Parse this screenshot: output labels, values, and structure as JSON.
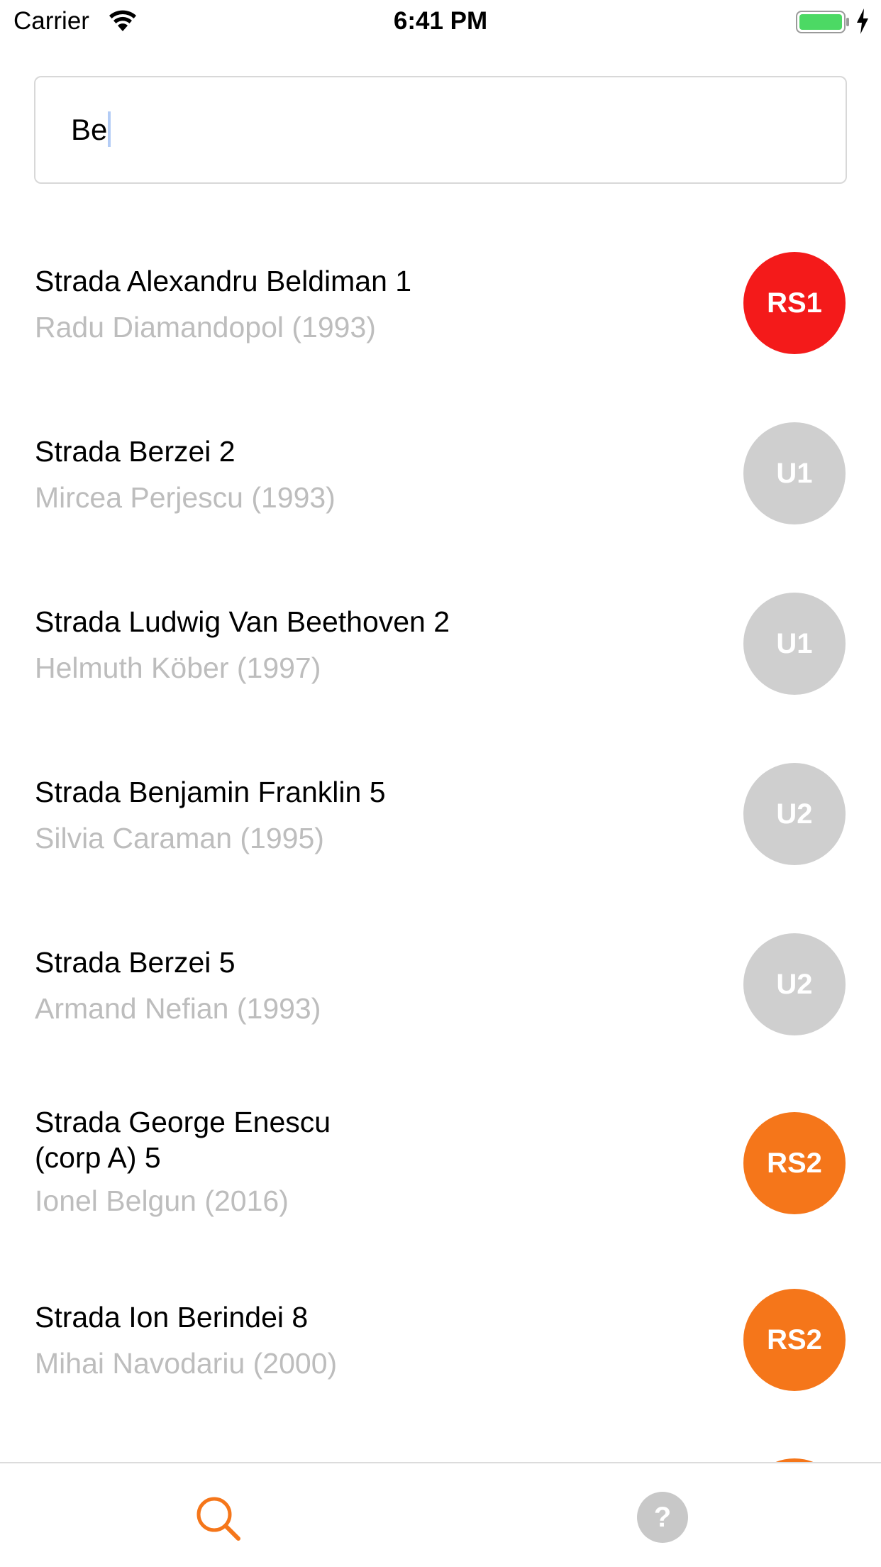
{
  "status_bar": {
    "carrier": "Carrier",
    "time": "6:41 PM",
    "battery_color": "#4cd964"
  },
  "search": {
    "value": "Be"
  },
  "results": [
    {
      "title": "Strada Alexandru Beldiman 1",
      "title2": "",
      "subtitle": "Radu Diamandopol (1993)",
      "badge": "RS1",
      "badge_color": "#f41a1a"
    },
    {
      "title": "Strada Berzei 2",
      "title2": "",
      "subtitle": "Mircea Perjescu (1993)",
      "badge": "U1",
      "badge_color": "#cfcfcf"
    },
    {
      "title": "Strada Ludwig Van Beethoven 2",
      "title2": "",
      "subtitle": "Helmuth Köber (1997)",
      "badge": "U1",
      "badge_color": "#cfcfcf"
    },
    {
      "title": "Strada Benjamin Franklin 5",
      "title2": "",
      "subtitle": "Silvia Caraman (1995)",
      "badge": "U2",
      "badge_color": "#cfcfcf"
    },
    {
      "title": "Strada Berzei 5",
      "title2": "",
      "subtitle": "Armand Nefian (1993)",
      "badge": "U2",
      "badge_color": "#cfcfcf"
    },
    {
      "title": "Strada George Enescu",
      "title2": " (corp A) 5",
      "subtitle": "Ionel Belgun (2016)",
      "badge": "RS2",
      "badge_color": "#f5761a"
    },
    {
      "title": "Strada Ion Berindei 8",
      "title2": "",
      "subtitle": "Mihai Navodariu (2000)",
      "badge": "RS2",
      "badge_color": "#f5761a"
    }
  ],
  "tab_bar": {
    "search_icon": "search-icon",
    "help_icon": "help-icon",
    "help_glyph": "?",
    "active_color": "#f5761a"
  }
}
